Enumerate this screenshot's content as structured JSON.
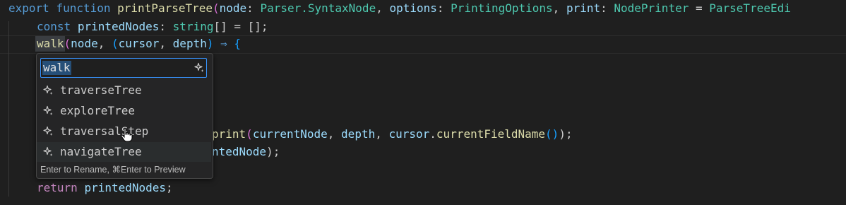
{
  "code": {
    "line1": {
      "export": "export",
      "function": "function",
      "name": "printParseTree",
      "open": "(",
      "p1": "node",
      "c1": ": ",
      "t1": "Parser.SyntaxNode",
      "comma1": ", ",
      "p2": "options",
      "c2": ": ",
      "t2": "PrintingOptions",
      "comma2": ", ",
      "p3": "print",
      "c3": ": ",
      "t3": "NodePrinter",
      "eq": " = ",
      "def": "ParseTreeEdi"
    },
    "line2": {
      "const": "const",
      "var": "printedNodes",
      "colon": ": ",
      "type": "string",
      "rest": "[] = [];"
    },
    "line3": {
      "fn": "walk",
      "open": "(",
      "arg": "node",
      "comma": ", ",
      "paren": "(",
      "p1": "cursor",
      "comma2": ", ",
      "p2": "depth",
      "close": ")",
      "arrow": " ⇒ ",
      "brace": "{"
    },
    "line6": {
      "fn": "print",
      "open": "(",
      "a1": "currentNode",
      "c1": ", ",
      "a2": "depth",
      "c2": ", ",
      "a3": "cursor",
      "dot": ".",
      "a4": "currentFieldName",
      "call": "()",
      "close": ");"
    },
    "line7": {
      "partial": "ntedNode",
      "close": ");"
    },
    "line9": {
      "return": "return",
      "var": "printedNodes",
      "semi": ";"
    }
  },
  "rename": {
    "input_value": "walk",
    "suggestions": [
      {
        "label": "traverseTree"
      },
      {
        "label": "exploreTree"
      },
      {
        "label": "traversalStep"
      },
      {
        "label": "navigateTree"
      }
    ],
    "footer": "Enter to Rename, ⌘Enter to Preview",
    "icon": "sparkle-icon"
  }
}
